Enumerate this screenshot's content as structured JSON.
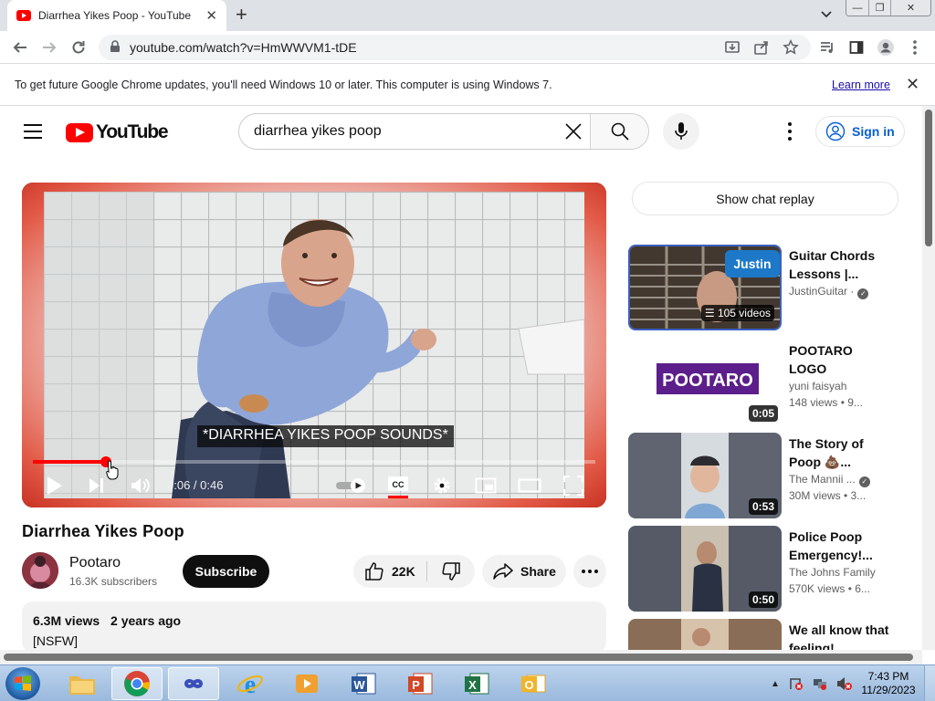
{
  "browser": {
    "tab_title": "Diarrhea Yikes Poop - YouTube",
    "url": "youtube.com/watch?v=HmWWVM1-tDE",
    "info_message": "To get future Google Chrome updates, you'll need Windows 10 or later. This computer is using Windows 7.",
    "learn_more": "Learn more"
  },
  "youtube": {
    "logo_text": "YouTube",
    "search_query": "diarrhea yikes poop",
    "sign_in": "Sign in"
  },
  "player": {
    "caption": "*DIARRHEA YIKES POOP SOUNDS*",
    "time": "0:06 / 0:46",
    "progress": 0.13
  },
  "video": {
    "title": "Diarrhea Yikes Poop",
    "channel": "Pootaro",
    "subscribers": "16.3K subscribers",
    "subscribe": "Subscribe",
    "likes": "22K",
    "share": "Share",
    "views": "6.3M views",
    "age": "2 years ago",
    "description": "[NSFW]"
  },
  "sidebar": {
    "chat_replay": "Show chat replay",
    "items": [
      {
        "title": "Guitar Chords Lessons |...",
        "channel": "JustinGuitar ·",
        "verified": true,
        "badge": "105 videos",
        "thumb_text": "Justin GUITAR"
      },
      {
        "title": "POOTARO LOGO",
        "channel": "yuni faisyah",
        "meta": "148 views • 9...",
        "duration": "0:05",
        "thumb_text": "POOTARO"
      },
      {
        "title": "The Story of Poop 💩...",
        "channel": "The Mannii ...",
        "verified": true,
        "meta": "30M views • 3...",
        "duration": "0:53"
      },
      {
        "title": "Police Poop Emergency!...",
        "channel": "The Johns Family",
        "meta": "570K views • 6...",
        "duration": "0:50"
      },
      {
        "title": "We all know that feeling!..."
      }
    ]
  },
  "taskbar": {
    "time": "7:43 PM",
    "date": "11/29/2023"
  },
  "colors": {
    "yt_red": "#ff0000",
    "link_blue": "#065fd4",
    "taskbar": "#bcd3ec"
  }
}
